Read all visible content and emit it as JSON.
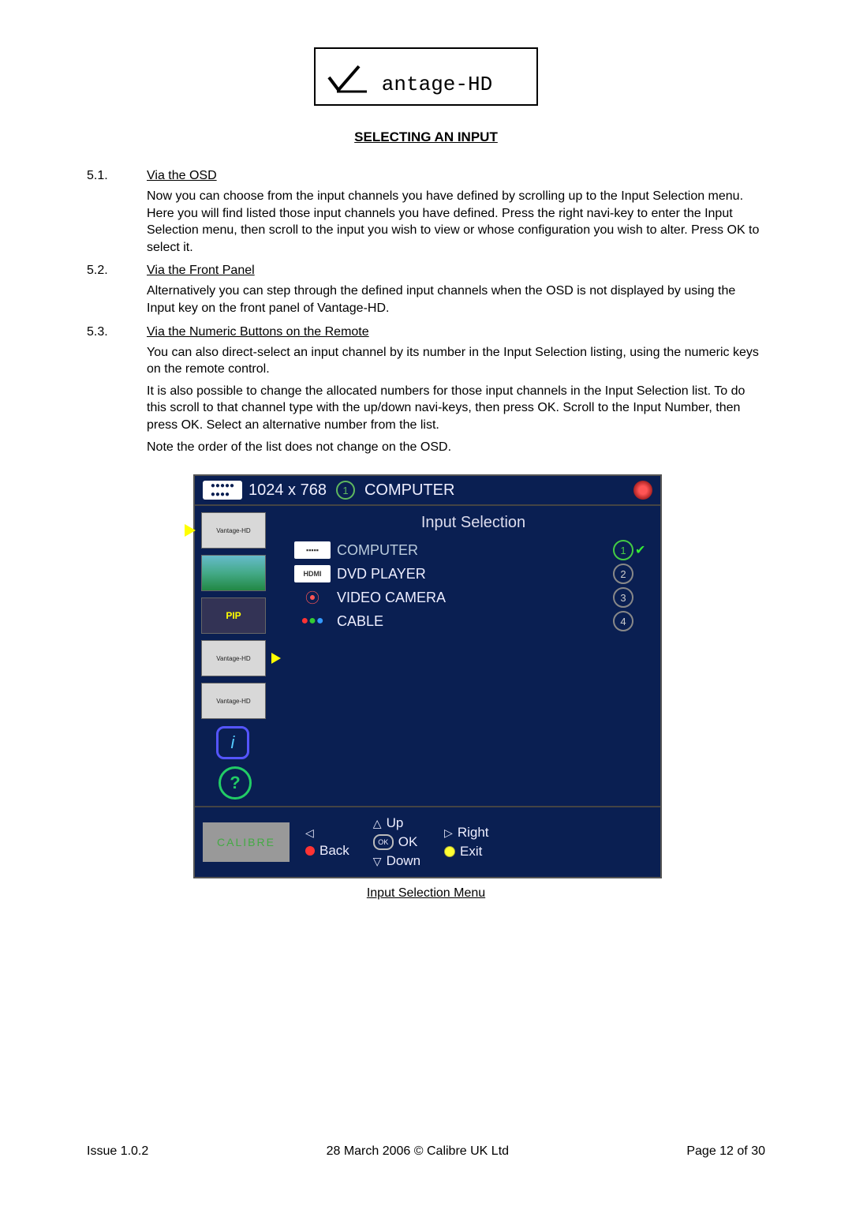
{
  "logo": {
    "text": "antage-HD"
  },
  "title": "SELECTING AN INPUT",
  "sections": {
    "s51": {
      "num": "5.1.",
      "title": "Via the OSD",
      "p1": "Now you can choose from the input channels you have defined by scrolling up to the Input Selection menu.  Here you will find listed those input channels you have defined.  Press the right navi-key to enter the Input Selection menu, then scroll to the input you wish to view or whose configuration you wish to alter.  Press OK to select it."
    },
    "s52": {
      "num": "5.2.",
      "title": "Via the Front Panel",
      "p1": "Alternatively you can step through the defined input channels when the OSD is not displayed by using the Input key on the front panel of Vantage-HD."
    },
    "s53": {
      "num": "5.3.",
      "title": "Via the Numeric Buttons on the Remote",
      "p1": "You can also direct-select an input channel by its number in the Input Selection listing, using the numeric keys on the remote control.",
      "p2": "It is also possible to change the allocated numbers for those input channels in the Input Selection list. To do this scroll to that channel type with the up/down navi-keys, then press OK. Scroll to the Input Number, then press OK. Select an alternative number from the list.",
      "p3": "Note the order of the list does not change on the OSD."
    }
  },
  "osd": {
    "header": {
      "resolution": "1024 x 768",
      "channel_num": "1",
      "channel_name": "COMPUTER"
    },
    "main_title": "Input Selection",
    "items": [
      {
        "icon": "vga",
        "label": "COMPUTER",
        "num": "1",
        "active": true
      },
      {
        "icon": "hdmi",
        "icon_text": "HDMI",
        "label": "DVD PLAYER",
        "num": "2",
        "active": false
      },
      {
        "icon": "cam",
        "label": "VIDEO CAMERA",
        "num": "3",
        "active": false
      },
      {
        "icon": "cable",
        "label": "CABLE",
        "num": "4",
        "active": false
      }
    ],
    "sidebar": {
      "item1": "Vantage-HD",
      "pip": "PIP",
      "item3": "Vantage-HD",
      "item4": "Vantage-HD",
      "info": "i",
      "help": "?"
    },
    "footer": {
      "brand": "CALIBRE",
      "back": "Back",
      "up": "Up",
      "ok": "OK",
      "down": "Down",
      "right": "Right",
      "exit": "Exit"
    }
  },
  "caption": "Input Selection Menu",
  "footer": {
    "left": "Issue 1.0.2",
    "center": "28 March 2006 © Calibre UK Ltd",
    "right": "Page 12 of 30"
  }
}
